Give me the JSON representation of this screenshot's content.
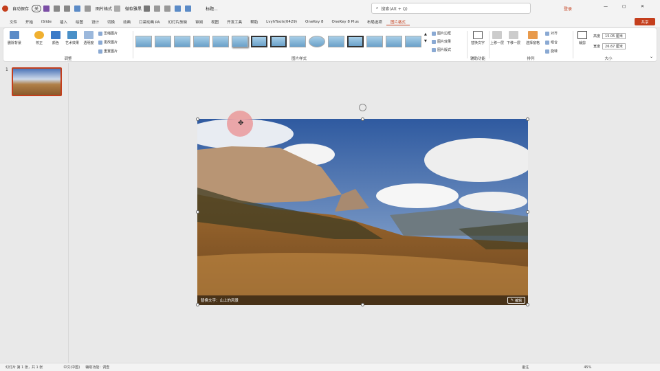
{
  "qat": {
    "autosave_label": "自动保存",
    "autosave_state": "关",
    "picture_format_btn": "图片格式",
    "font_name": "微软雅黑",
    "title_btn": "标题..."
  },
  "search": {
    "placeholder": "搜索(Alt + Q)"
  },
  "window": {
    "account_warning": "登录"
  },
  "menu": {
    "tabs": [
      "文件",
      "开始",
      "iSlide",
      "插入",
      "绘图",
      "设计",
      "切换",
      "动画",
      "口袋动画 PA",
      "幻灯片放映",
      "审阅",
      "视图",
      "开发工具",
      "帮助",
      "LvyhTools(0429)",
      "OneKey 8",
      "OneKey 8 Plus",
      "布局选项",
      "图片格式"
    ],
    "active_tab": "图片格式",
    "share_label": "共享"
  },
  "ribbon": {
    "adjust": {
      "label": "调整",
      "remove_bg": "删除背景",
      "corrections": "校正",
      "color": "颜色",
      "art_effects": "艺术效果",
      "transparency": "透明度",
      "compress": "压缩图片",
      "change": "更改图片",
      "reset": "重置图片"
    },
    "styles": {
      "label": "图片样式",
      "border": "图片边框",
      "effects": "图片效果",
      "layout": "图片版式",
      "gallery_count": 15
    },
    "accessibility": {
      "label": "辅助功能",
      "alt_text": "替换文字"
    },
    "arrange": {
      "label": "排列",
      "bring_forward": "上移一层",
      "send_backward": "下移一层",
      "selection_pane": "选择窗格",
      "align": "对齐",
      "group": "组合",
      "rotate": "旋转"
    },
    "size": {
      "label": "大小",
      "crop": "裁剪",
      "height_label": "高度",
      "height_value": "15.05 厘米",
      "width_label": "宽度",
      "width_value": "26.67 厘米"
    }
  },
  "slides": {
    "number": "1"
  },
  "image": {
    "caption": "替换文字：山上的风景",
    "edit_label": "编辑"
  },
  "status": {
    "slide_info": "幻灯片 第 1 张，共 1 张",
    "language": "中文(中国)",
    "accessibility": "辅助功能：调查",
    "notes": "备注",
    "zoom": "45%"
  },
  "colors": {
    "accent": "#c43e1c",
    "ribbon_bg": "#ffffff",
    "workspace_bg": "#e9e9e9"
  }
}
